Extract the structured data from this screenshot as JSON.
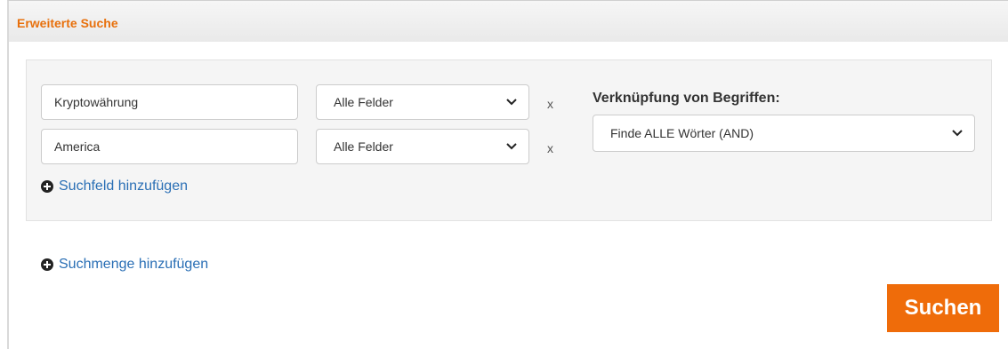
{
  "header": {
    "title": "Erweiterte Suche"
  },
  "search_rows": [
    {
      "term": "Kryptowährung",
      "field": "Alle Felder",
      "remove": "x"
    },
    {
      "term": "America",
      "field": "Alle Felder",
      "remove": "x"
    }
  ],
  "add_field_label": "Suchfeld hinzufügen",
  "join": {
    "label": "Verknüpfung von Begriffen:",
    "selected": "Finde ALLE Wörter (AND)"
  },
  "add_group_label": "Suchmenge hinzufügen",
  "search_button": "Suchen",
  "colors": {
    "accent": "#ef6c0a",
    "title": "#e8700c",
    "link": "#2a6fb5"
  }
}
